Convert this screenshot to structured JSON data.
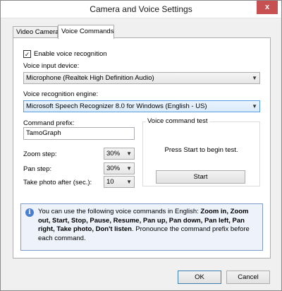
{
  "window": {
    "title": "Camera and Voice Settings",
    "close_glyph": "x"
  },
  "tabs": [
    {
      "label": "Video Camera",
      "active": false
    },
    {
      "label": "Voice Commands",
      "active": true
    }
  ],
  "voice": {
    "enable_label": "Enable voice recognition",
    "enable_checked": true,
    "input_device_label": "Voice input device:",
    "input_device_value": "Microphone (Realtek High Definition Audio)",
    "engine_label": "Voice recognition engine:",
    "engine_value": "Microsoft Speech Recognizer 8.0 for Windows (English - US)",
    "prefix_label": "Command prefix:",
    "prefix_value": "TamoGraph",
    "zoom_label": "Zoom step:",
    "zoom_value": "30%",
    "pan_label": "Pan step:",
    "pan_value": "30%",
    "photo_label": "Take photo after (sec.):",
    "photo_value": "10"
  },
  "test": {
    "group_title": "Voice command test",
    "prompt": "Press Start to begin test.",
    "start_label": "Start"
  },
  "info": {
    "intro": "You can use the following voice commands in English: ",
    "commands": "Zoom in, Zoom out, Start, Stop, Pause, Resume, Pan up, Pan down, Pan left, Pan right, Take photo, Don't listen",
    "outro": ". Pronounce the command prefix before each command."
  },
  "footer": {
    "ok_label": "OK",
    "cancel_label": "Cancel"
  },
  "icons": {
    "info": "info-icon",
    "check": "checkmark-icon",
    "dropdown": "chevron-down-icon"
  },
  "colors": {
    "close_button": "#c75050",
    "info_border": "#7b9bc9",
    "info_background": "#eef2fb",
    "focus_border": "#569de5"
  }
}
